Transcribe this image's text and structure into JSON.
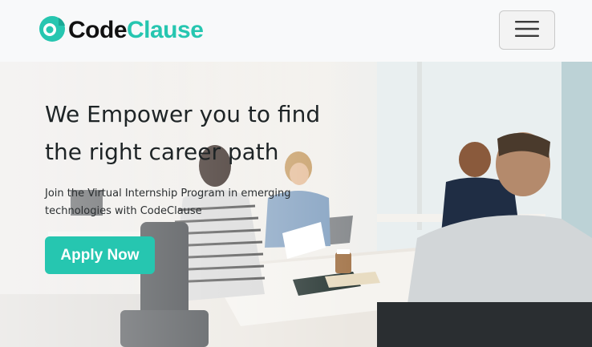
{
  "nav": {
    "brand_code": "Code",
    "brand_clause": "Clause",
    "logo_icon": "codeclause-logo-icon",
    "menu_icon": "hamburger-menu-icon"
  },
  "hero": {
    "title_line1": "We Empower you to find",
    "title_line2": "the right career path",
    "subtitle_line1": "Join the Virtual Internship Program in emerging",
    "subtitle_line2": "technologies with CodeClause",
    "cta_label": "Apply Now"
  },
  "colors": {
    "brand_accent": "#26c6b0",
    "navbar_bg": "#f8f9fa",
    "text_dark": "#1e2426"
  }
}
